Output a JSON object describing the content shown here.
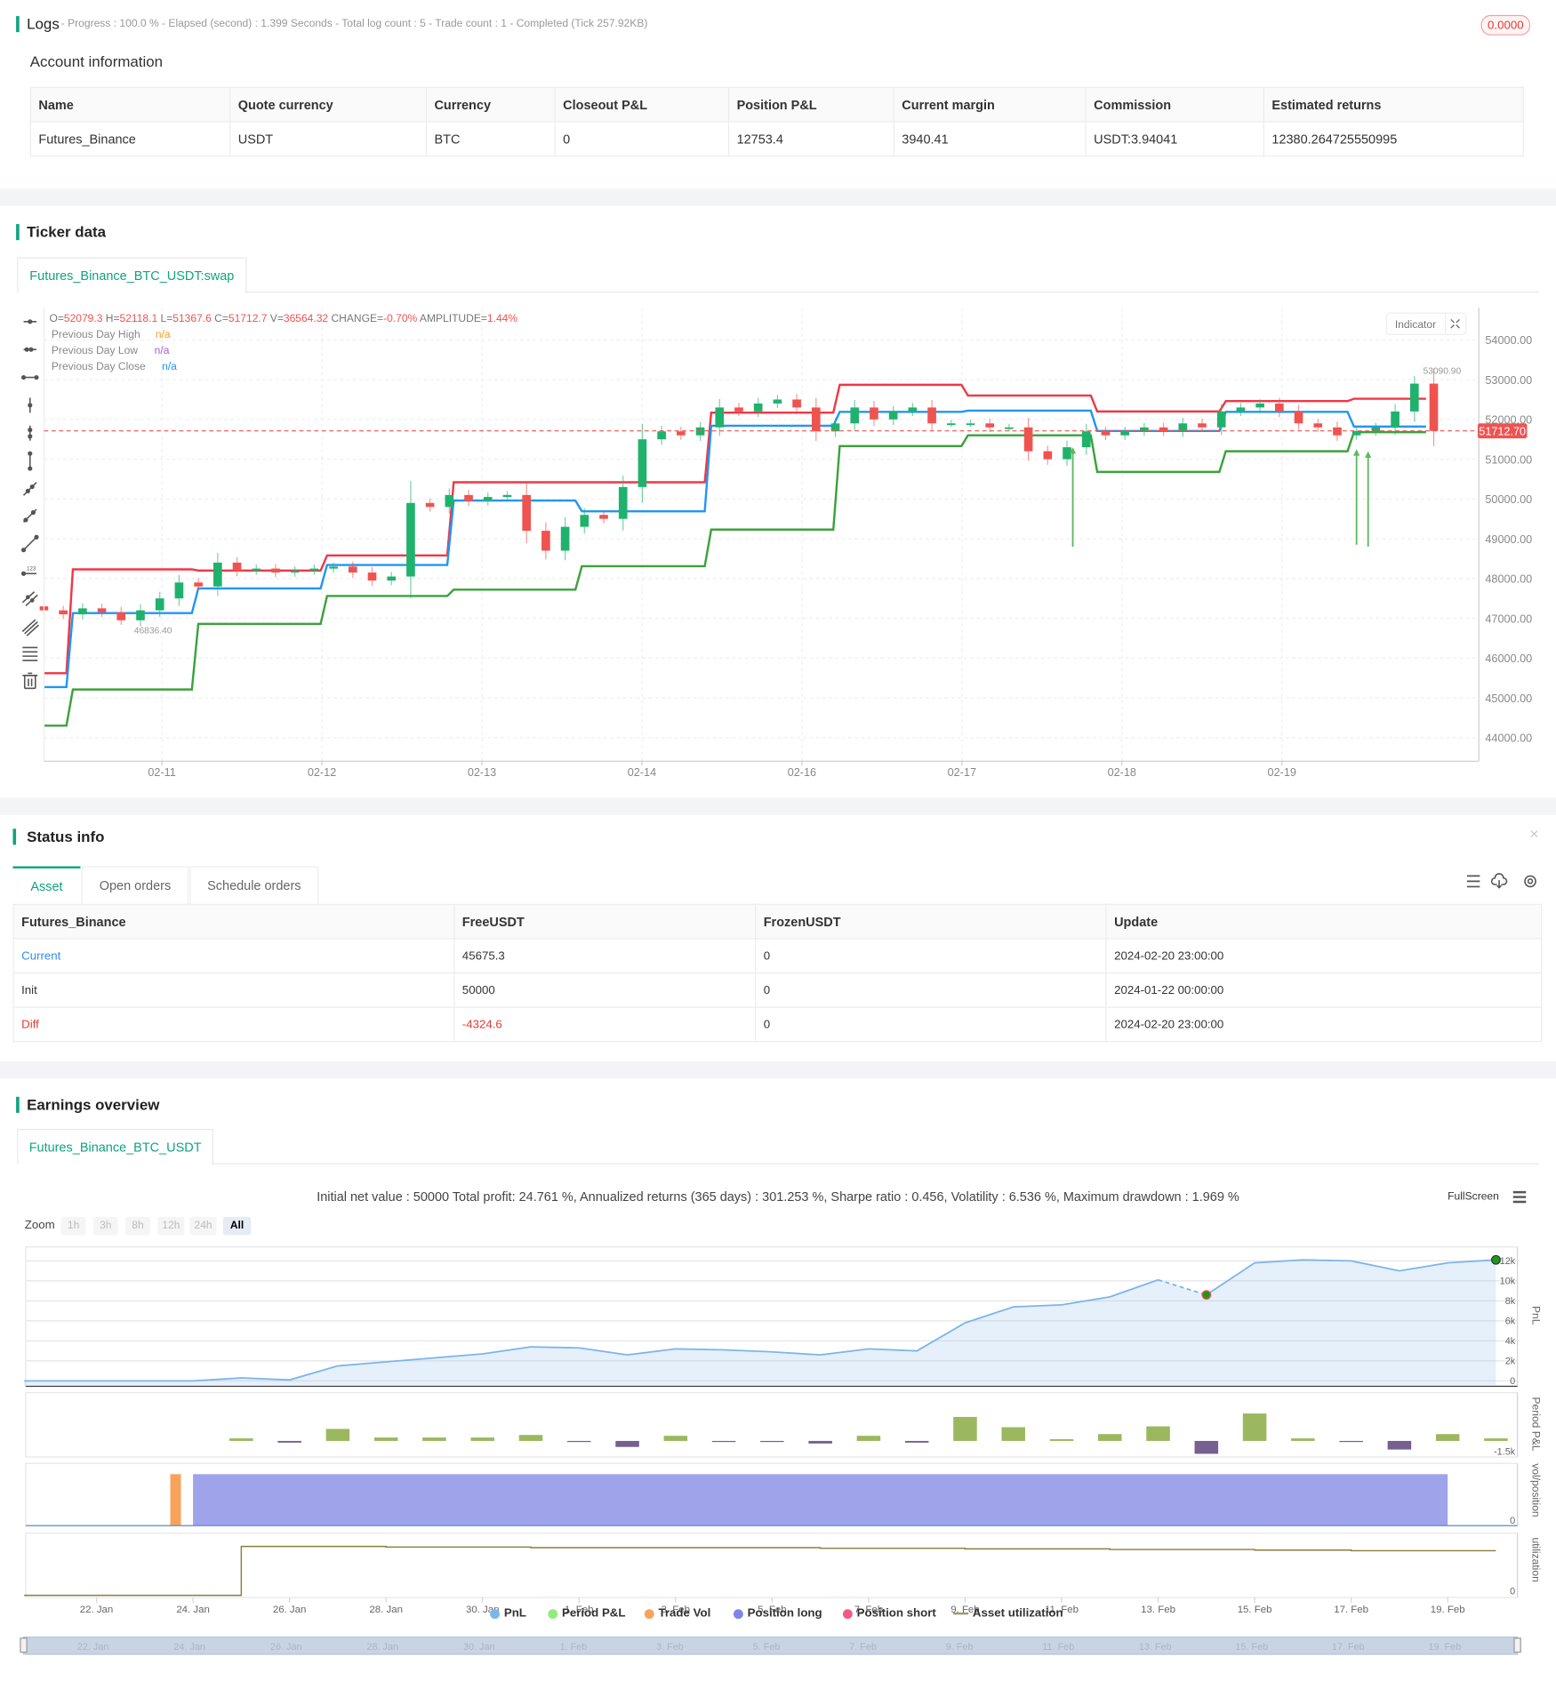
{
  "logs": {
    "title": "Logs",
    "summary": "- Progress : 100.0 % - Elapsed (second) : 1.399  Seconds - Total log count : 5 - Trade count : 1 - Completed (Tick 257.92KB)",
    "badge": "0.0000"
  },
  "account": {
    "title": "Account information",
    "headers": [
      "Name",
      "Quote currency",
      "Currency",
      "Closeout P&L",
      "Position P&L",
      "Current margin",
      "Commission",
      "Estimated returns"
    ],
    "row": [
      "Futures_Binance",
      "USDT",
      "BTC",
      "0",
      "12753.4",
      "3940.41",
      "USDT:3.94041",
      "12380.264725550995"
    ]
  },
  "ticker": {
    "title": "Ticker data",
    "tab": "Futures_Binance_BTC_USDT:swap",
    "ohlc": {
      "o_label": "O=",
      "o": "52079.3",
      "h_label": " H=",
      "h": "52118.1",
      "l_label": " L=",
      "l": "51367.6",
      "c_label": " C=",
      "c": "51712.7",
      "v_label": " V=",
      "v": "36564.32",
      "change_label": " CHANGE=",
      "change": "-0.70%",
      "amp_label": " AMPLITUDE=",
      "amp": "1.44%"
    },
    "legend": [
      {
        "label": "Previous Day High",
        "value": "n/a",
        "color": "#f7a21b"
      },
      {
        "label": "Previous Day Low",
        "value": "n/a",
        "color": "#a45ee5"
      },
      {
        "label": "Previous Day Close",
        "value": "n/a",
        "color": "#2196f3"
      }
    ],
    "indicator_button": "Indicator",
    "current_price_tag": "51712.70",
    "high_annotation": "53090.90",
    "low_annotation": "46836.40"
  },
  "status": {
    "title": "Status info",
    "tabs": [
      "Asset",
      "Open orders",
      "Schedule orders"
    ],
    "headers": [
      "Futures_Binance",
      "FreeUSDT",
      "FrozenUSDT",
      "Update"
    ],
    "rows": [
      [
        "Current",
        "45675.3",
        "0",
        "2024-02-20 23:00:00"
      ],
      [
        "Init",
        "50000",
        "0",
        "2024-01-22 00:00:00"
      ],
      [
        "Diff",
        "-4324.6",
        "0",
        "2024-02-20 23:00:00"
      ]
    ]
  },
  "earnings": {
    "title": "Earnings overview",
    "tab": "Futures_Binance_BTC_USDT",
    "stats": "Initial net value : 50000 Total profit: 24.761 %, Annualized returns (365 days) : 301.253 %, Sharpe ratio : 0.456, Volatility : 6.536 %, Maximum drawdown : 1.969 %",
    "fullscreen": "FullScreen",
    "zoom_label": "Zoom",
    "zoom_buttons": [
      "1h",
      "3h",
      "8h",
      "12h",
      "24h",
      "All"
    ],
    "legend": [
      "PnL",
      "Period P&L",
      "Trade Vol",
      "Position long",
      "Position short",
      "Asset utilization"
    ],
    "axis_titles": [
      "PnL",
      "Period P&L",
      "vol/position",
      "utilization"
    ]
  },
  "chart_data": [
    {
      "type": "candlestick",
      "title": "Futures_Binance_BTC_USDT:swap",
      "x_tick_labels": [
        "02-11",
        "02-12",
        "02-13",
        "02-14",
        "02-16",
        "02-17",
        "02-18",
        "02-19"
      ],
      "y_tick_labels": [
        "54000.00",
        "53000.00",
        "52000.00",
        "51000.00",
        "50000.00",
        "49000.00",
        "48000.00",
        "47000.00",
        "46000.00",
        "45000.00",
        "44000.00"
      ],
      "ylim": [
        43700,
        54500
      ],
      "closes": [
        47200,
        47100,
        47250,
        47150,
        46950,
        47200,
        47500,
        47900,
        47800,
        48400,
        48200,
        48250,
        48150,
        48200,
        48250,
        48300,
        48150,
        47950,
        48050,
        49900,
        49800,
        50100,
        49950,
        50050,
        50100,
        49200,
        48700,
        49300,
        49600,
        49500,
        50300,
        51500,
        51700,
        51600,
        51800,
        52300,
        52200,
        52400,
        52500,
        52300,
        51700,
        51900,
        52300,
        52000,
        52200,
        52300,
        51900,
        51900,
        51900,
        51800,
        51800,
        51200,
        51000,
        51300,
        51700,
        51600,
        51700,
        51800,
        51700,
        51900,
        51800,
        52200,
        52300,
        52400,
        52200,
        51900,
        51800,
        51600,
        51700,
        51800,
        52200,
        52900,
        51712.7
      ],
      "first_open": 47300,
      "max_high": 53090.9,
      "min_low": 46836.4,
      "current_price": 51712.7,
      "levels": [
        {
          "start": 0,
          "high": 45620,
          "close": 45270,
          "low": 44300
        },
        {
          "start": 1.33,
          "high": 48230,
          "close": 47130,
          "low": 45210
        },
        {
          "start": 7.83,
          "high": 48200,
          "close": 47750,
          "low": 46860
        },
        {
          "start": 14.5,
          "high": 48580,
          "close": 48340,
          "low": 47560
        },
        {
          "start": 21.06,
          "high": 50420,
          "close": 49960,
          "low": 47720
        },
        {
          "start": 27.7,
          "high": 50420,
          "close": 49690,
          "low": 48310
        },
        {
          "start": 34.4,
          "high": 52170,
          "close": 51840,
          "low": 49230
        },
        {
          "start": 41.06,
          "high": 52870,
          "close": 52190,
          "low": 51330
        },
        {
          "start": 47.7,
          "high": 52600,
          "close": 52220,
          "low": 51600
        },
        {
          "start": 54.4,
          "high": 52200,
          "close": 51710,
          "low": 50680
        },
        {
          "start": 61.06,
          "high": 52460,
          "close": 52190,
          "low": 51200
        },
        {
          "start": 67.7,
          "high": 52520,
          "close": 51820,
          "low": 51680
        }
      ],
      "end_index": 71.6,
      "buy_signals": [
        {
          "index": 53.3,
          "from": 48800,
          "to": 51300
        },
        {
          "index": 68,
          "from": 48850,
          "to": 51250
        },
        {
          "index": 68.6,
          "from": 48800,
          "to": 51200
        }
      ]
    },
    {
      "type": "area",
      "title": "PnL",
      "x_tick_labels": [
        "22. Jan",
        "24. Jan",
        "26. Jan",
        "28. Jan",
        "30. Jan",
        "1. Feb",
        "3. Feb",
        "5. Feb",
        "7. Feb",
        "9. Feb",
        "11. Feb",
        "13. Feb",
        "15. Feb",
        "17. Feb",
        "19. Feb"
      ],
      "x_days_from_jan22": [
        -1.5,
        2,
        3,
        4,
        5,
        6,
        7,
        8,
        9,
        10,
        11,
        12,
        13,
        14,
        15,
        16,
        17,
        18,
        19,
        20,
        21,
        22,
        23,
        24,
        25,
        26,
        27,
        28,
        29
      ],
      "pnl_k": [
        0,
        0,
        0.3,
        0.1,
        1.5,
        1.9,
        2.3,
        2.7,
        3.4,
        3.3,
        2.6,
        3.2,
        3.1,
        2.9,
        2.6,
        3.2,
        3.0,
        5.8,
        7.4,
        7.6,
        8.4,
        10.1,
        8.6,
        11.8,
        12.1,
        12.0,
        11.0,
        11.8,
        12.1
      ],
      "y_tick_labels": [
        "12k",
        "10k",
        "8k",
        "6k",
        "4k",
        "2k",
        "0"
      ],
      "ylim": [
        0,
        12
      ],
      "period_pnl_k": [
        0.3,
        -0.2,
        1.4,
        0.4,
        0.4,
        0.4,
        0.7,
        -0.1,
        -0.7,
        0.6,
        -0.1,
        -0.1,
        -0.3,
        0.6,
        -0.2,
        2.8,
        1.6,
        0.2,
        0.8,
        1.7,
        -1.5,
        3.2,
        0.3,
        -0.1,
        -1.0,
        0.8,
        0.3
      ],
      "period_days_from_jan22": [
        3,
        4,
        5,
        6,
        7,
        8,
        9,
        10,
        11,
        12,
        13,
        14,
        15,
        16,
        17,
        18,
        19,
        20,
        21,
        22,
        23,
        24,
        25,
        26,
        27,
        28,
        29
      ],
      "period_min_label": "-1.5k",
      "trade_vol_day": 1.75,
      "position_long": {
        "from_day": 2.0,
        "to_day": 28.0
      },
      "utilization_days": [
        -1.5,
        3,
        6,
        9,
        12,
        15,
        18,
        21,
        24,
        26,
        29
      ],
      "utilization": [
        0,
        0.8,
        0.79,
        0.78,
        0.78,
        0.77,
        0.76,
        0.75,
        0.74,
        0.73,
        0.73
      ],
      "zero_label": "0"
    }
  ]
}
